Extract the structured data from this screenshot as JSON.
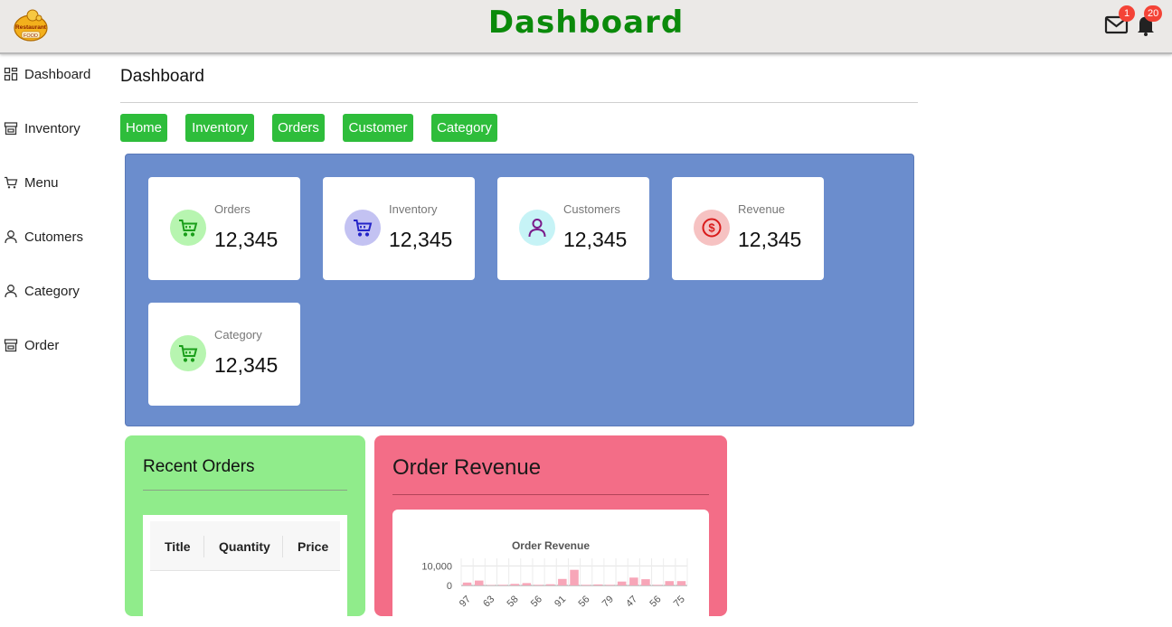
{
  "header": {
    "title": "Dashboard",
    "logo_icon": "restaurant-food-logo",
    "logo_text": [
      "Restaurant",
      "FOOD"
    ],
    "mail_badge": "1",
    "bell_badge": "20"
  },
  "sidebar": {
    "items": [
      {
        "label": "Dashboard",
        "icon": "dashboard-grid-icon"
      },
      {
        "label": "Inventory",
        "icon": "store-icon"
      },
      {
        "label": "Menu",
        "icon": "cart-icon"
      },
      {
        "label": "Cutomers",
        "icon": "user-icon"
      },
      {
        "label": "Category",
        "icon": "user-icon"
      },
      {
        "label": "Order",
        "icon": "store-icon"
      }
    ]
  },
  "page": {
    "title": "Dashboard"
  },
  "breadcrumbs": [
    "Home",
    "Inventory",
    "Orders",
    "Customer",
    "Category"
  ],
  "stats": [
    {
      "label": "Orders",
      "value": "12,345",
      "icon": "cart-icon",
      "icon_bg": "#b7f5b0",
      "icon_color": "#1a9e1a"
    },
    {
      "label": "Inventory",
      "value": "12,345",
      "icon": "cart-icon",
      "icon_bg": "#c3c2f2",
      "icon_color": "#2424c8"
    },
    {
      "label": "Customers",
      "value": "12,345",
      "icon": "user-icon",
      "icon_bg": "#c6f3f6",
      "icon_color": "#7a1a8a"
    },
    {
      "label": "Revenue",
      "value": "12,345",
      "icon": "dollar-icon",
      "icon_bg": "#f6c2c2",
      "icon_color": "#d91a1a"
    },
    {
      "label": "Category",
      "value": "12,345",
      "icon": "cart-icon",
      "icon_bg": "#b7f5b0",
      "icon_color": "#1a9e1a"
    }
  ],
  "recent_orders": {
    "title": "Recent Orders",
    "columns": [
      "Title",
      "Quantity",
      "Price"
    ]
  },
  "order_revenue": {
    "title": "Order Revenue"
  },
  "chart_data": {
    "type": "bar",
    "title": "Order Revenue",
    "xlabel": "",
    "ylabel": "",
    "y_ticks": [
      "10,000",
      "0"
    ],
    "ylim": [
      0,
      12000
    ],
    "categories": [
      "97",
      "",
      "63",
      "",
      "58",
      "",
      "56",
      "",
      "91",
      "",
      "56",
      "",
      "79",
      "",
      "47",
      "",
      "56",
      "",
      "75"
    ],
    "values": [
      1500,
      2500,
      200,
      300,
      800,
      1200,
      300,
      600,
      3300,
      8000,
      300,
      500,
      300,
      2000,
      4000,
      3200,
      300,
      2200,
      2200
    ],
    "bar_color": "#f7a6b8",
    "grid": true,
    "legend": "none"
  }
}
